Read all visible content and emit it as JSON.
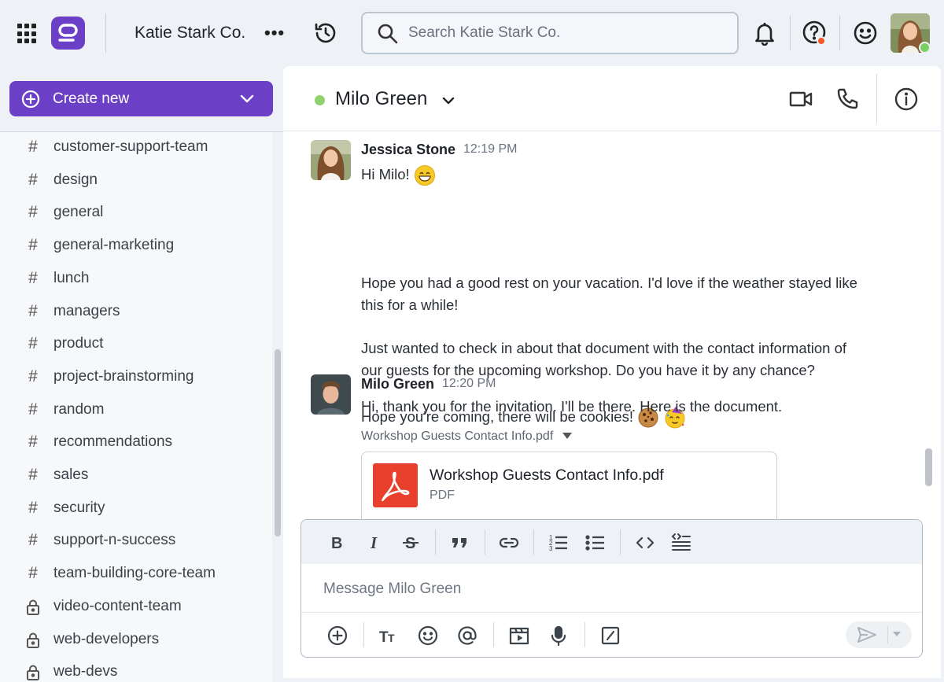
{
  "topbar": {
    "team_name": "Katie Stark Co.",
    "more_label": "•••",
    "search_placeholder": "Search Katie Stark Co."
  },
  "sidebar": {
    "create_label": "Create new",
    "channels": [
      {
        "name": "customer-support-team",
        "private": false
      },
      {
        "name": "design",
        "private": false
      },
      {
        "name": "general",
        "private": false
      },
      {
        "name": "general-marketing",
        "private": false
      },
      {
        "name": "lunch",
        "private": false
      },
      {
        "name": "managers",
        "private": false
      },
      {
        "name": "product",
        "private": false
      },
      {
        "name": "project-brainstorming",
        "private": false
      },
      {
        "name": "random",
        "private": false
      },
      {
        "name": "recommendations",
        "private": false
      },
      {
        "name": "sales",
        "private": false
      },
      {
        "name": "security",
        "private": false
      },
      {
        "name": "support-n-success",
        "private": false
      },
      {
        "name": "team-building-core-team",
        "private": false
      },
      {
        "name": "video-content-team",
        "private": true
      },
      {
        "name": "web-developers",
        "private": true
      },
      {
        "name": "web-devs",
        "private": true
      }
    ]
  },
  "chat": {
    "title": "Milo Green",
    "messages": [
      {
        "author": "Jessica Stone",
        "time": "12:19 PM",
        "lines": [
          "Hi Milo!",
          "Hope you had a good rest on your vacation. I'd love if the weather stayed like",
          "this for a while!",
          "Just wanted to check in about that document with the contact information of",
          "our guests for the upcoming workshop. Do you have it by any chance?",
          "Hope you're coming, there will be cookies!"
        ]
      },
      {
        "author": "Milo Green",
        "time": "12:20 PM",
        "lines": [
          "Hi, thank you for the invitation. I'll be there. Here is the document."
        ],
        "attachment": {
          "caption": "Workshop Guests Contact Info.pdf",
          "file_name": "Workshop Guests Contact Info.pdf",
          "file_type": "PDF"
        }
      }
    ]
  },
  "composer": {
    "placeholder": "Message Milo Green"
  },
  "colors": {
    "brand": "#6c3fc7",
    "presence": "#8ed26e",
    "alert": "#f25a27",
    "pdf": "#e8402c"
  },
  "icons": [
    "apps-grid-icon",
    "logo-icon",
    "history-icon",
    "search-icon",
    "bell-icon",
    "help-icon",
    "smile-icon",
    "video-icon",
    "phone-icon",
    "info-icon",
    "pdf-icon",
    "send-icon"
  ]
}
